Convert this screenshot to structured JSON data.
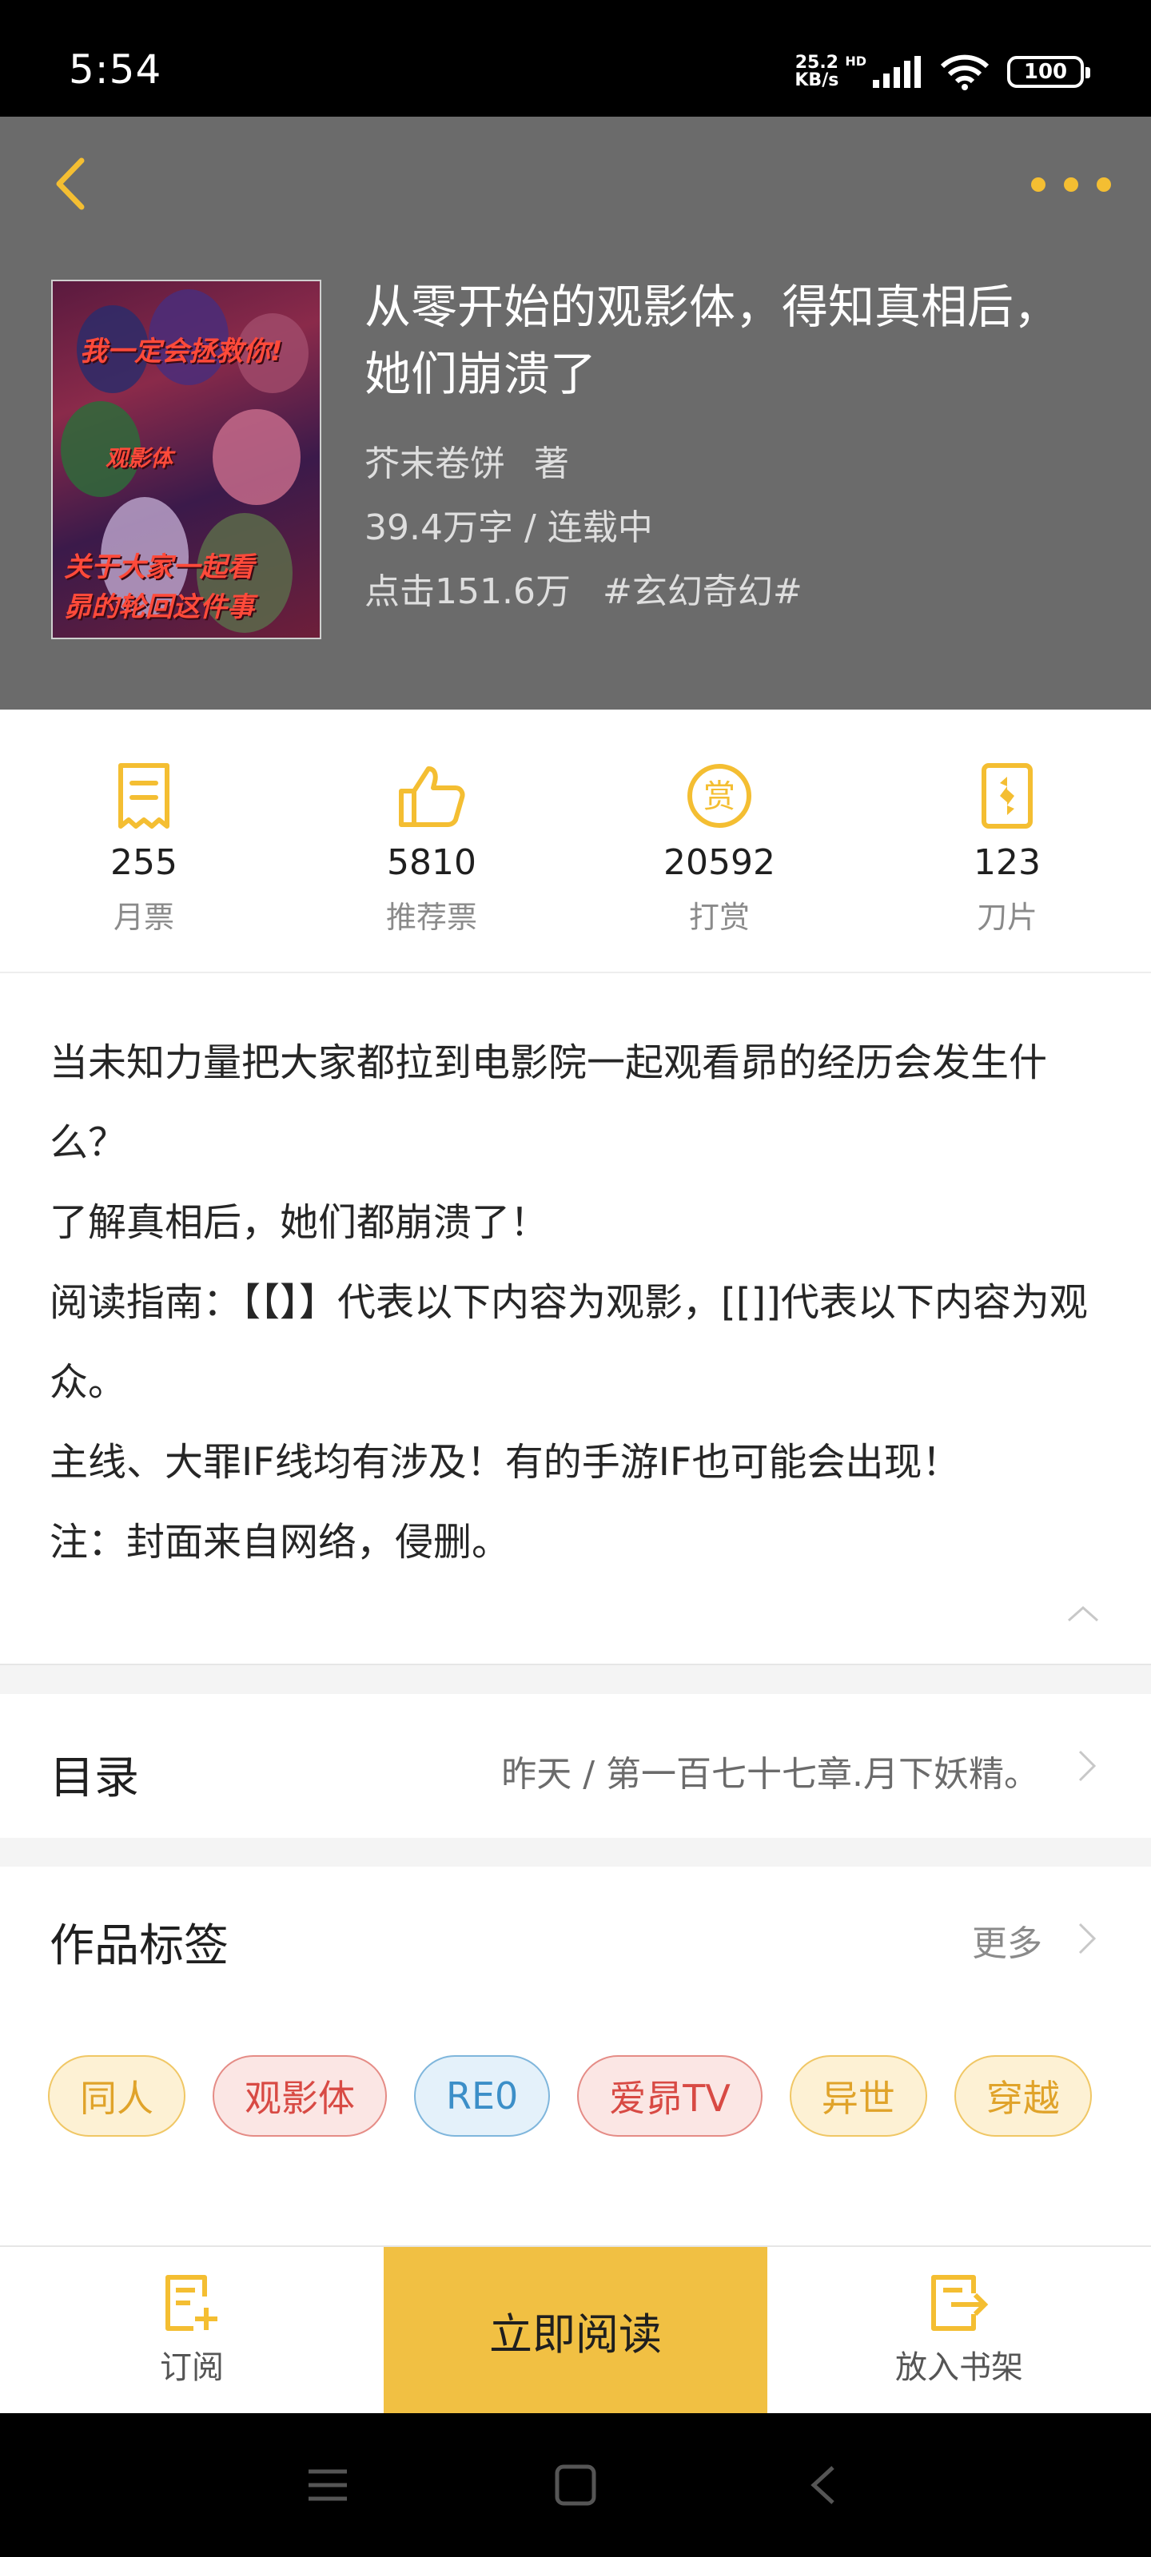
{
  "status_bar": {
    "time": "5:54",
    "net_speed_value": "25.2",
    "net_speed_unit": "KB/s",
    "hd": "HD",
    "battery": "100"
  },
  "book": {
    "title": "从零开始的观影体，得知真相后，她们崩溃了",
    "author": "芥末卷饼",
    "author_suffix": "著",
    "words_status": "39.4万字 / 连载中",
    "clicks": "点击151.6万",
    "genre": "#玄幻奇幻#",
    "cover_text": [
      "我一定会拯救你!",
      "观影体",
      "关于大家一起看",
      "昴的轮回这件事"
    ]
  },
  "stats": [
    {
      "icon": "monthly-ticket-icon",
      "value": "255",
      "label": "月票"
    },
    {
      "icon": "thumbs-up-icon",
      "value": "5810",
      "label": "推荐票"
    },
    {
      "icon": "reward-coin-icon",
      "value": "20592",
      "label": "打赏"
    },
    {
      "icon": "blade-card-icon",
      "value": "123",
      "label": "刀片"
    }
  ],
  "description": [
    "当未知力量把大家都拉到电影院一起观看昴的经历会发生什么？",
    "了解真相后，她们都崩溃了！",
    "阅读指南：【【】】代表以下内容为观影，[[]]代表以下内容为观众。",
    "主线、大罪IF线均有涉及！有的手游IF也可能会出现！",
    "注：封面来自网络，侵删。"
  ],
  "toc": {
    "title": "目录",
    "latest": "昨天 / 第一百七十七章.月下妖精。"
  },
  "tags": {
    "title": "作品标签",
    "more": "更多",
    "items": [
      {
        "label": "同人",
        "style": "gold"
      },
      {
        "label": "观影体",
        "style": "red"
      },
      {
        "label": "RE0",
        "style": "blue"
      },
      {
        "label": "爱昴TV",
        "style": "red"
      },
      {
        "label": "异世",
        "style": "gold"
      },
      {
        "label": "穿越",
        "style": "gold"
      }
    ]
  },
  "bottom_bar": {
    "subscribe": "订阅",
    "read_now": "立即阅读",
    "add_shelf": "放入书架"
  },
  "colors": {
    "accent": "#f4be32",
    "header_bg": "#6b6b6b",
    "read_button": "#f1c043"
  }
}
